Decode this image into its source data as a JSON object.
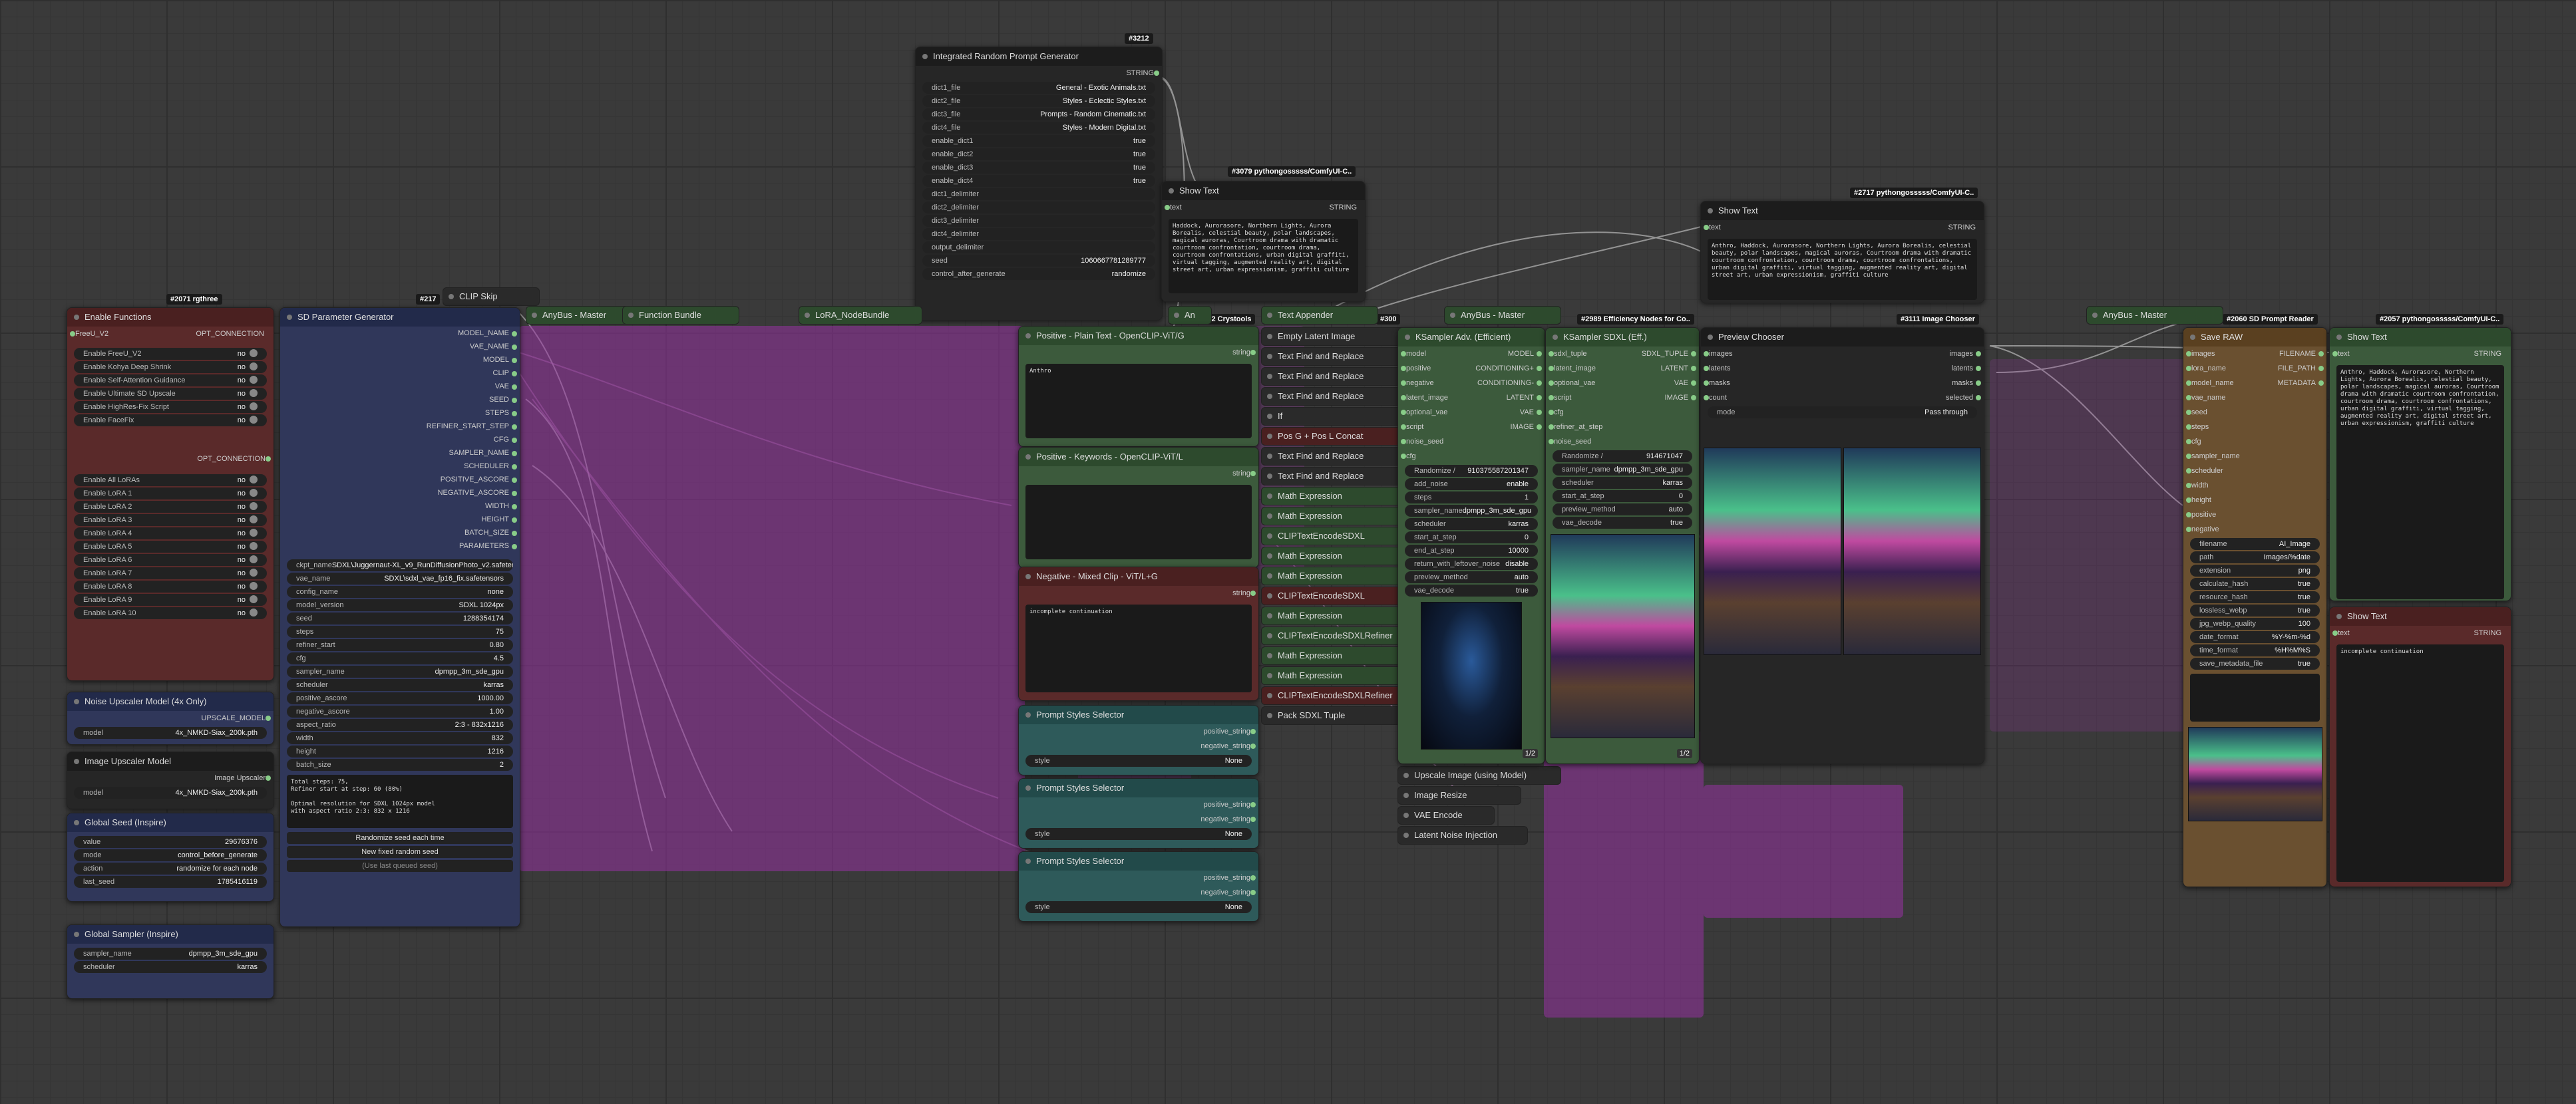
{
  "badges": {
    "irpg": "#3212",
    "showtext1": "#3079 pythongosssss/ComfyUI-C..",
    "showtext2": "#2717 pythongosssss/ComfyUI-C..",
    "crystools": "#3052 Crystools",
    "efficiency": "#2989 Efficiency Nodes for Co..",
    "imagechooser": "#3111 Image Chooser",
    "sdprompt": "#2060 SD Prompt Reader",
    "showtext3": "#2057 pythongosssss/ComfyUI-C..",
    "rgthree1": "#2071 rgthree",
    "rgthree2": "#217",
    "n300": "#300"
  },
  "irpg": {
    "title": "Integrated Random Prompt Generator",
    "out": "STRING",
    "widgets": [
      {
        "label": "dict1_file",
        "value": "General - Exotic Animals.txt"
      },
      {
        "label": "dict2_file",
        "value": "Styles - Eclectic Styles.txt"
      },
      {
        "label": "dict3_file",
        "value": "Prompts - Random Cinematic.txt"
      },
      {
        "label": "dict4_file",
        "value": "Styles - Modern Digital.txt"
      },
      {
        "label": "enable_dict1",
        "value": "true"
      },
      {
        "label": "enable_dict2",
        "value": "true"
      },
      {
        "label": "enable_dict3",
        "value": "true"
      },
      {
        "label": "enable_dict4",
        "value": "true"
      },
      {
        "label": "dict1_delimiter",
        "value": ""
      },
      {
        "label": "dict2_delimiter",
        "value": ""
      },
      {
        "label": "dict3_delimiter",
        "value": ""
      },
      {
        "label": "dict4_delimiter",
        "value": ""
      },
      {
        "label": "output_delimiter",
        "value": ""
      },
      {
        "label": "seed",
        "value": "1060667781289777"
      },
      {
        "label": "control_after_generate",
        "value": "randomize"
      }
    ]
  },
  "showtext1": {
    "title": "Show Text",
    "in": "text",
    "out": "STRING",
    "content": "Haddock, Aurorasore, Northern Lights, Aurora Borealis, celestial beauty, polar landscapes, magical auroras, Courtroom drama with dramatic courtroom confrontation, courtroom drama, courtroom confrontations, urban digital graffiti, virtual tagging, augmented reality art, digital street art, urban expressionism, graffiti culture"
  },
  "showtext2": {
    "title": "Show Text",
    "in": "text",
    "out": "STRING",
    "content": "Anthro, Haddock, Aurorasore, Northern Lights, Aurora Borealis, celestial beauty, polar landscapes, magical auroras, Courtroom drama with dramatic courtroom confrontation, courtroom drama, courtroom confrontations, urban digital graffiti, virtual tagging, augmented reality art, digital street art, urban expressionism, graffiti culture"
  },
  "enable_functions": {
    "title": "Enable Functions",
    "slot_in": "FreeU_V2",
    "out": "OPT_CONNECTION",
    "toggles": [
      {
        "label": "Enable FreeU_V2",
        "value": "no"
      },
      {
        "label": "Enable Kohya Deep Shrink",
        "value": "no"
      },
      {
        "label": "Enable Self-Attention Guidance",
        "value": "no"
      },
      {
        "label": "Enable Ultimate SD Upscale",
        "value": "no"
      },
      {
        "label": "Enable HighRes-Fix Script",
        "value": "no"
      },
      {
        "label": "Enable FaceFix",
        "value": "no"
      }
    ],
    "out2": "OPT_CONNECTION",
    "toggles2": [
      {
        "label": "Enable All LoRAs",
        "value": "no"
      },
      {
        "label": "Enable LoRA 1",
        "value": "no"
      },
      {
        "label": "Enable LoRA 2",
        "value": "no"
      },
      {
        "label": "Enable LoRA 3",
        "value": "no"
      },
      {
        "label": "Enable LoRA 4",
        "value": "no"
      },
      {
        "label": "Enable LoRA 5",
        "value": "no"
      },
      {
        "label": "Enable LoRA 6",
        "value": "no"
      },
      {
        "label": "Enable LoRA 7",
        "value": "no"
      },
      {
        "label": "Enable LoRA 8",
        "value": "no"
      },
      {
        "label": "Enable LoRA 9",
        "value": "no"
      },
      {
        "label": "Enable LoRA 10",
        "value": "no"
      }
    ]
  },
  "noise_upscaler": {
    "title": "Noise Upscaler Model (4x Only)",
    "out": "UPSCALE_MODEL",
    "widget": {
      "label": "model",
      "value": "4x_NMKD-Siax_200k.pth"
    }
  },
  "image_upscaler": {
    "title": "Image Upscaler Model",
    "out": "Image Upscaler",
    "widget": {
      "label": "model",
      "value": "4x_NMKD-Siax_200k.pth"
    }
  },
  "global_seed": {
    "title": "Global Seed (Inspire)",
    "widgets": [
      {
        "label": "value",
        "value": "29676376"
      },
      {
        "label": "mode",
        "value": "control_before_generate"
      },
      {
        "label": "action",
        "value": "randomize for each node"
      },
      {
        "label": "last_seed",
        "value": "1785416119"
      }
    ]
  },
  "global_sampler": {
    "title": "Global Sampler (Inspire)",
    "widgets": [
      {
        "label": "sampler_name",
        "value": "dpmpp_3m_sde_gpu"
      },
      {
        "label": "scheduler",
        "value": "karras"
      }
    ]
  },
  "sdparam": {
    "title": "SD Parameter Generator",
    "outputs": [
      "MODEL_NAME",
      "VAE_NAME",
      "MODEL",
      "CLIP",
      "VAE",
      "SEED",
      "STEPS",
      "REFINER_START_STEP",
      "CFG",
      "SAMPLER_NAME",
      "SCHEDULER",
      "POSITIVE_ASCORE",
      "NEGATIVE_ASCORE",
      "WIDTH",
      "HEIGHT",
      "BATCH_SIZE",
      "PARAMETERS"
    ],
    "widgets": [
      {
        "label": "ckpt_name",
        "value": "SDXL\\Juggernaut-XL_v9_RunDiffusionPhoto_v2.safetensors"
      },
      {
        "label": "vae_name",
        "value": "SDXL\\sdxl_vae_fp16_fix.safetensors"
      },
      {
        "label": "config_name",
        "value": "none"
      },
      {
        "label": "model_version",
        "value": "SDXL 1024px"
      },
      {
        "label": "seed",
        "value": "1288354174"
      },
      {
        "label": "steps",
        "value": "75"
      },
      {
        "label": "refiner_start",
        "value": "0.80"
      },
      {
        "label": "cfg",
        "value": "4.5"
      },
      {
        "label": "sampler_name",
        "value": "dpmpp_3m_sde_gpu"
      },
      {
        "label": "scheduler",
        "value": "karras"
      },
      {
        "label": "positive_ascore",
        "value": "1000.00"
      },
      {
        "label": "negative_ascore",
        "value": "1.00"
      },
      {
        "label": "aspect_ratio",
        "value": "2:3 - 832x1216"
      },
      {
        "label": "width",
        "value": "832"
      },
      {
        "label": "height",
        "value": "1216"
      },
      {
        "label": "batch_size",
        "value": "2"
      }
    ],
    "info": "Total steps: 75,\nRefiner start at step: 60 (80%)\n\nOptimal resolution for SDXL 1024px model\nwith aspect ratio 2:3: 832 x 1216",
    "btn1": "Randomize seed each time",
    "btn2": "New fixed random seed",
    "btn3": "(Use last queued seed)"
  },
  "mini": {
    "clip_skip": "CLIP Skip",
    "anybus1": "AnyBus - Master",
    "function_bundle": "Function Bundle",
    "lora_nodebundle": "LoRA_NodeBundle",
    "an": "An",
    "text_appender": "Text Appender",
    "anybus2": "AnyBus - Master",
    "anybus3": "AnyBus - Master"
  },
  "pos_plain": {
    "title": "Positive - Plain Text - OpenCLIP-ViT/G",
    "out": "string",
    "content": "Anthro"
  },
  "pos_keywords": {
    "title": "Positive - Keywords - OpenCLIP-ViT/L",
    "out": "string",
    "content": ""
  },
  "neg_mixed": {
    "title": "Negative - Mixed Clip - ViT/L+G",
    "out": "string",
    "content": "incomplete continuation"
  },
  "styles": [
    {
      "title": "Prompt Styles Selector",
      "out1": "positive_string",
      "out2": "negative_string",
      "widget": {
        "label": "style",
        "value": "None"
      }
    },
    {
      "title": "Prompt Styles Selector",
      "out1": "positive_string",
      "out2": "negative_string",
      "widget": {
        "label": "style",
        "value": "None"
      }
    },
    {
      "title": "Prompt Styles Selector",
      "out1": "positive_string",
      "out2": "negative_string",
      "widget": {
        "label": "style",
        "value": "None"
      }
    }
  ],
  "midnodes": [
    "Empty Latent Image",
    "Text Find and Replace",
    "Text Find and Replace",
    "Text Find and Replace",
    "If",
    "Pos G + Pos L Concat",
    "Text Find and Replace",
    "Text Find and Replace",
    "Math Expression",
    "Math Expression",
    "CLIPTextEncodeSDXL",
    "Math Expression",
    "Math Expression",
    "CLIPTextEncodeSDXL",
    "Math Expression",
    "CLIPTextEncodeSDXLRefiner",
    "Math Expression",
    "Math Expression",
    "CLIPTextEncodeSDXLRefiner",
    "Pack SDXL Tuple"
  ],
  "ksampler_adv": {
    "title": "KSampler Adv. (Efficient)",
    "inputs": [
      "model",
      "positive",
      "negative",
      "latent_image",
      "optional_vae",
      "script"
    ],
    "outputs": [
      "MODEL",
      "CONDITIONING+",
      "CONDITIONING-",
      "LATENT",
      "VAE",
      "IMAGE"
    ],
    "extra_in": [
      "noise_seed",
      "cfg"
    ],
    "seed_label": "Randomize /",
    "seed_value": "910375587201347",
    "widgets": [
      {
        "label": "add_noise",
        "value": "enable"
      },
      {
        "label": "steps",
        "value": "1"
      },
      {
        "label": "sampler_name",
        "value": "dpmpp_3m_sde_gpu"
      },
      {
        "label": "scheduler",
        "value": "karras"
      },
      {
        "label": "start_at_step",
        "value": "0"
      },
      {
        "label": "end_at_step",
        "value": "10000"
      },
      {
        "label": "return_with_leftover_noise",
        "value": "disable"
      },
      {
        "label": "preview_method",
        "value": "auto"
      },
      {
        "label": "vae_decode",
        "value": "true"
      }
    ],
    "counter": "1/2"
  },
  "ksampler_sdxl": {
    "title": "KSampler SDXL (Eff.)",
    "inputs": [
      "sdxl_tuple",
      "latent_image",
      "optional_vae",
      "script"
    ],
    "outputs": [
      "SDXL_TUPLE",
      "LATENT",
      "VAE",
      "IMAGE"
    ],
    "extra_in": [
      "cfg",
      "refiner_at_step",
      "noise_seed"
    ],
    "seed_label": "Randomize /",
    "seed_value": "914671047",
    "widgets": [
      {
        "label": "sampler_name",
        "value": "dpmpp_3m_sde_gpu"
      },
      {
        "label": "scheduler",
        "value": "karras"
      },
      {
        "label": "start_at_step",
        "value": "0"
      },
      {
        "label": "preview_method",
        "value": "auto"
      },
      {
        "label": "vae_decode",
        "value": "true"
      }
    ],
    "counter": "1/2"
  },
  "lower_mid": [
    "Upscale Image (using Model)",
    "Image Resize",
    "VAE Encode",
    "Latent Noise Injection"
  ],
  "preview_chooser": {
    "title": "Preview Chooser",
    "inputs": [
      "images",
      "latents",
      "masks",
      "count"
    ],
    "outputs": [
      "images",
      "latents",
      "masks",
      "selected"
    ],
    "widget": {
      "label": "mode",
      "value": "Pass through"
    }
  },
  "save_raw": {
    "title": "Save RAW",
    "inputs": [
      "images",
      "lora_name",
      "model_name",
      "vae_name",
      "seed",
      "steps",
      "cfg",
      "sampler_name",
      "scheduler",
      "width",
      "height",
      "positive",
      "negative"
    ],
    "outputs": [
      "FILENAME",
      "FILE_PATH",
      "METADATA"
    ],
    "widgets": [
      {
        "label": "filename",
        "value": "AI_Image"
      },
      {
        "label": "path",
        "value": "Images/%date"
      },
      {
        "label": "extension",
        "value": "png"
      },
      {
        "label": "calculate_hash",
        "value": "true"
      },
      {
        "label": "resource_hash",
        "value": "true"
      },
      {
        "label": "lossless_webp",
        "value": "true"
      },
      {
        "label": "jpg_webp_quality",
        "value": "100"
      },
      {
        "label": "date_format",
        "value": "%Y-%m-%d"
      },
      {
        "label": "time_format",
        "value": "%H%M%S"
      },
      {
        "label": "save_metadata_file",
        "value": "true"
      }
    ]
  },
  "showtext3": {
    "title": "Show Text",
    "in": "text",
    "out": "STRING",
    "content": "Anthro, Haddock, Aurorasore, Northern Lights, Aurora Borealis, celestial beauty, polar landscapes, magical auroras, Courtroom drama with dramatic courtroom confrontation, courtroom drama, courtroom confrontations, urban digital graffiti, virtual tagging, augmented reality art, digital street art, urban expressionism, graffiti culture"
  },
  "showtext4": {
    "title": "Show Text",
    "in": "text",
    "out": "STRING",
    "content": "incomplete continuation"
  },
  "colors": {
    "node_bg": "#353535",
    "accent_green": "#8c8",
    "bypass": "#7a4a8a",
    "canvas": "#3a3a3a"
  }
}
